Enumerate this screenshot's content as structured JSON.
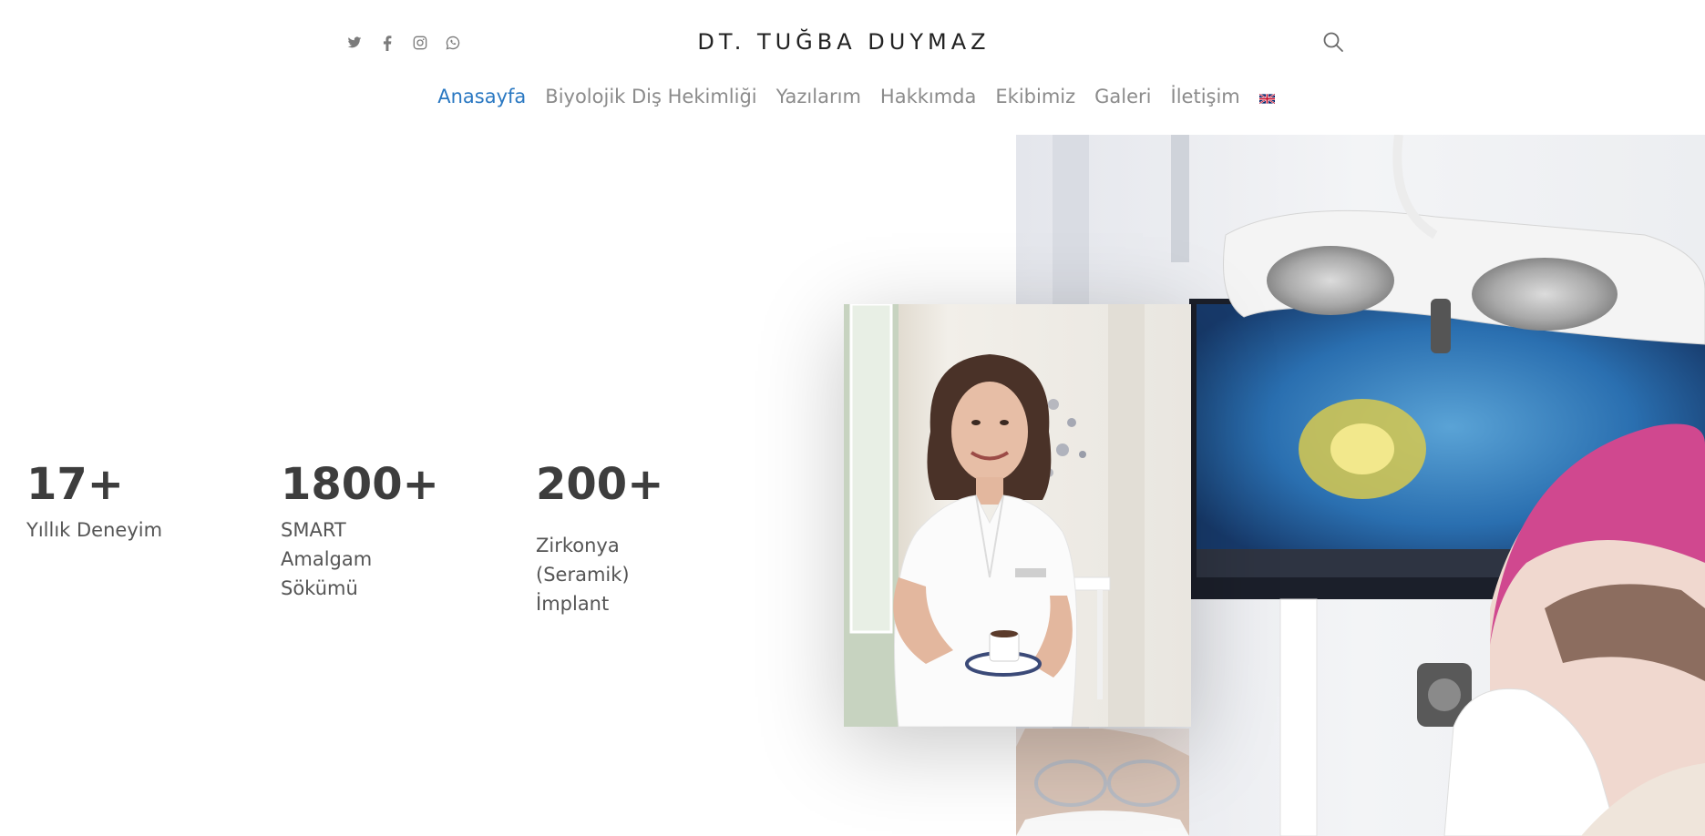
{
  "header": {
    "brand": "DT. TUĞBA DUYMAZ",
    "social_icons": [
      "twitter-icon",
      "facebook-icon",
      "instagram-icon",
      "whatsapp-icon"
    ],
    "search_icon": "search-icon"
  },
  "nav": {
    "items": [
      {
        "label": "Anasayfa",
        "active": true
      },
      {
        "label": "Biyolojik Diş Hekimliği",
        "active": false
      },
      {
        "label": "Yazılarım",
        "active": false
      },
      {
        "label": "Hakkımda",
        "active": false
      },
      {
        "label": "Ekibimiz",
        "active": false
      },
      {
        "label": "Galeri",
        "active": false
      },
      {
        "label": "İletişim",
        "active": false
      }
    ],
    "language_flag": "uk-flag-icon",
    "active_color": "#2a78c2",
    "inactive_color": "#8b8b8b"
  },
  "stats": [
    {
      "number": "17+",
      "label": "Yıllık Deneyim"
    },
    {
      "number": "1800+",
      "label": "SMART\nAmalgam\nSökümü"
    },
    {
      "number": "200+",
      "label": "Zirkonya\n(Seramik)\nİmplant"
    }
  ],
  "images": {
    "hero": "dentist-treatment-photo",
    "portrait": "dentist-portrait-photo"
  }
}
